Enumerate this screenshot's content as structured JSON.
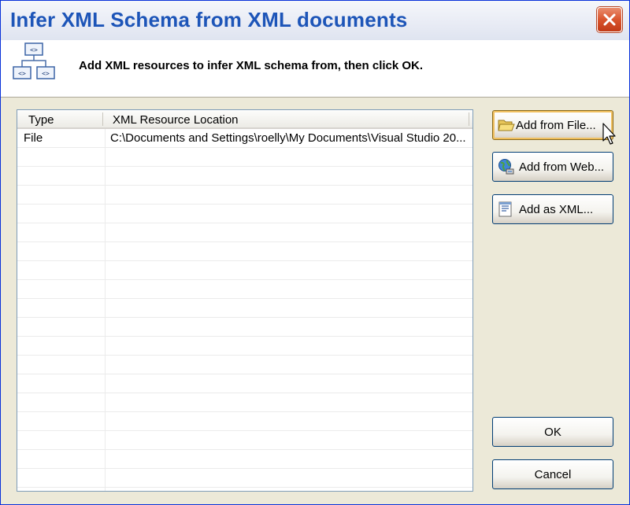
{
  "window": {
    "title": "Infer XML Schema from XML documents",
    "close_label": "X"
  },
  "header": {
    "instruction": "Add XML resources to infer XML schema from, then click OK."
  },
  "list": {
    "columns": [
      "Type",
      "XML Resource Location"
    ],
    "rows": [
      {
        "type": "File",
        "location": "C:\\Documents and Settings\\roelly\\My Documents\\Visual Studio 20..."
      }
    ]
  },
  "buttons": {
    "add_from_file": "Add from File...",
    "add_from_web": "Add from Web...",
    "add_as_xml": "Add as XML...",
    "ok": "OK",
    "cancel": "Cancel"
  },
  "colors": {
    "title_text": "#1d55b8",
    "dialog_bg": "#ece9d8",
    "close_button": "#d9542d",
    "focus_ring": "#f0c060"
  },
  "icons": {
    "header": "xml-schema-diagram-icon",
    "add_from_file": "open-folder-icon",
    "add_from_web": "globe-network-icon",
    "add_as_xml": "xml-document-icon"
  }
}
